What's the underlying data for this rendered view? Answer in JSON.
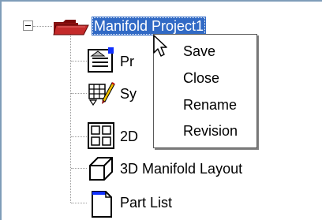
{
  "tree": {
    "root": {
      "label": "Manifold Project1",
      "icon": "folder-open-icon",
      "selected": true,
      "expanded": true
    },
    "children": [
      {
        "label": "Pr",
        "icon": "properties-icon"
      },
      {
        "label": "Sy",
        "icon": "symbol-editor-icon"
      },
      {
        "label": "2D",
        "icon": "grid-layout-icon"
      },
      {
        "label": "3D Manifold Layout",
        "icon": "cube-icon"
      },
      {
        "label": "Part List",
        "icon": "document-icon"
      }
    ]
  },
  "context_menu": {
    "items": [
      {
        "label": "Save"
      },
      {
        "label": "Close"
      },
      {
        "label": "Rename"
      },
      {
        "label": "Revision"
      }
    ]
  },
  "colors": {
    "selection_bg": "#316ac5",
    "folder_red": "#a01818",
    "accent_blue": "#1030ff"
  }
}
